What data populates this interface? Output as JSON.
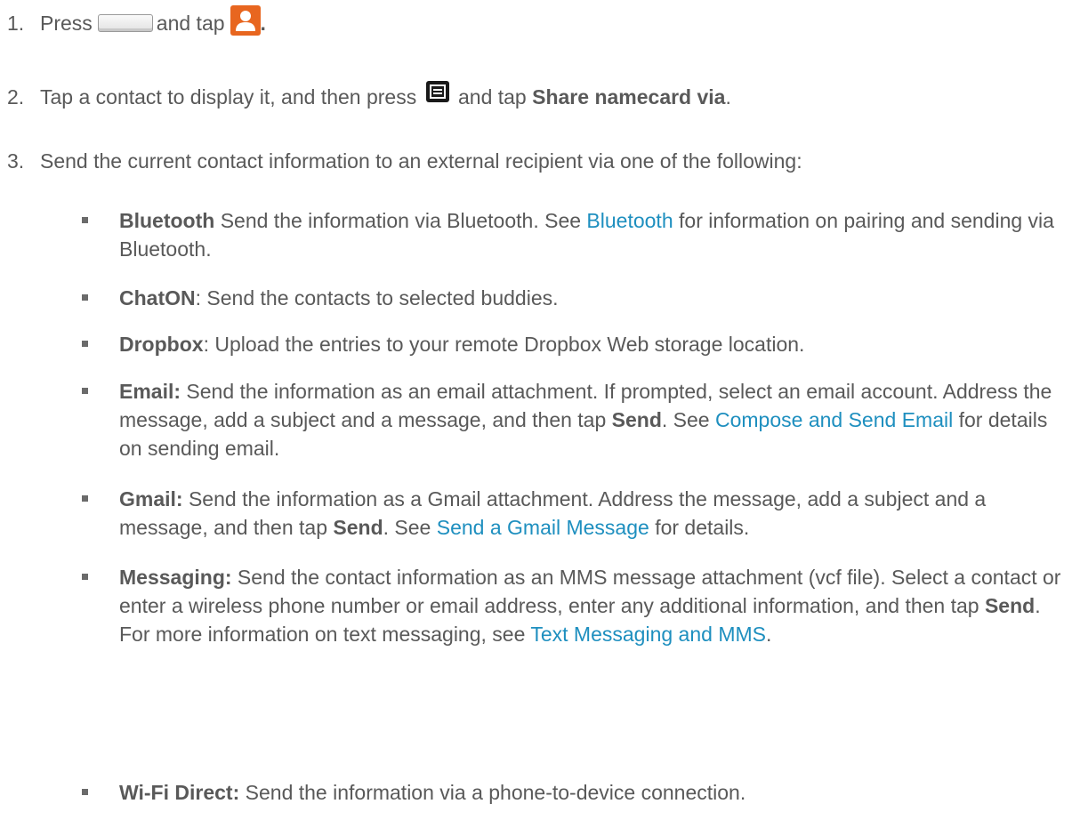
{
  "steps": [
    {
      "number": "1.",
      "text_press": "Press",
      "text_and_tap": "and tap",
      "trailing_period": "."
    },
    {
      "number": "2.",
      "text_before": "Tap a contact to display it, and then press",
      "text_and_tap": "and tap",
      "bold": "Share namecard via",
      "trailing_period": "."
    },
    {
      "number": "3.",
      "text": "Send the current contact information to an external recipient via one of the following:"
    }
  ],
  "options": [
    {
      "bold": "Bluetooth",
      "text1": " Send the information via Bluetooth. See ",
      "link1": "Bluetooth",
      "text2": " for information on pairing and sending via Bluetooth."
    },
    {
      "bold": "ChatON",
      "text1": ": Send the contacts to selected buddies."
    },
    {
      "bold": "Dropbox",
      "text1": ": Upload the entries to your remote Dropbox Web storage location."
    },
    {
      "bold": "Email:",
      "text1": " Send the information as an email attachment. If prompted, select an email account. Address the message, add a subject and a message, and then tap ",
      "bold2": "Send",
      "text2": ". See ",
      "link1": "Compose and Send Email",
      "text3": " for details on sending email."
    },
    {
      "bold": "Gmail:",
      "text1": " Send the information as a Gmail attachment. Address the message, add a subject and a message, and then tap ",
      "bold2": "Send",
      "text2": ". See ",
      "link1": "Send a Gmail Message",
      "text3": " for details."
    },
    {
      "bold": "Messaging:",
      "text1": " Send the contact information as an MMS message attachment (vcf file). Select a contact or enter a wireless phone number or email address, enter any additional information, and then tap ",
      "bold2": "Send",
      "text2": ". For more information on text messaging, see ",
      "link1": "Text Messaging and MMS",
      "text3": "."
    },
    {
      "bold": "Wi-Fi Direct:",
      "text1": " Send the information via a phone-to-device connection."
    }
  ],
  "icons": {
    "home_key": "home-key-icon",
    "contacts_app": "contacts-icon",
    "menu_key": "menu-key-icon"
  },
  "colors": {
    "body_text": "#595959",
    "link": "#1e8fbf",
    "contacts_icon": "#e8661f"
  }
}
